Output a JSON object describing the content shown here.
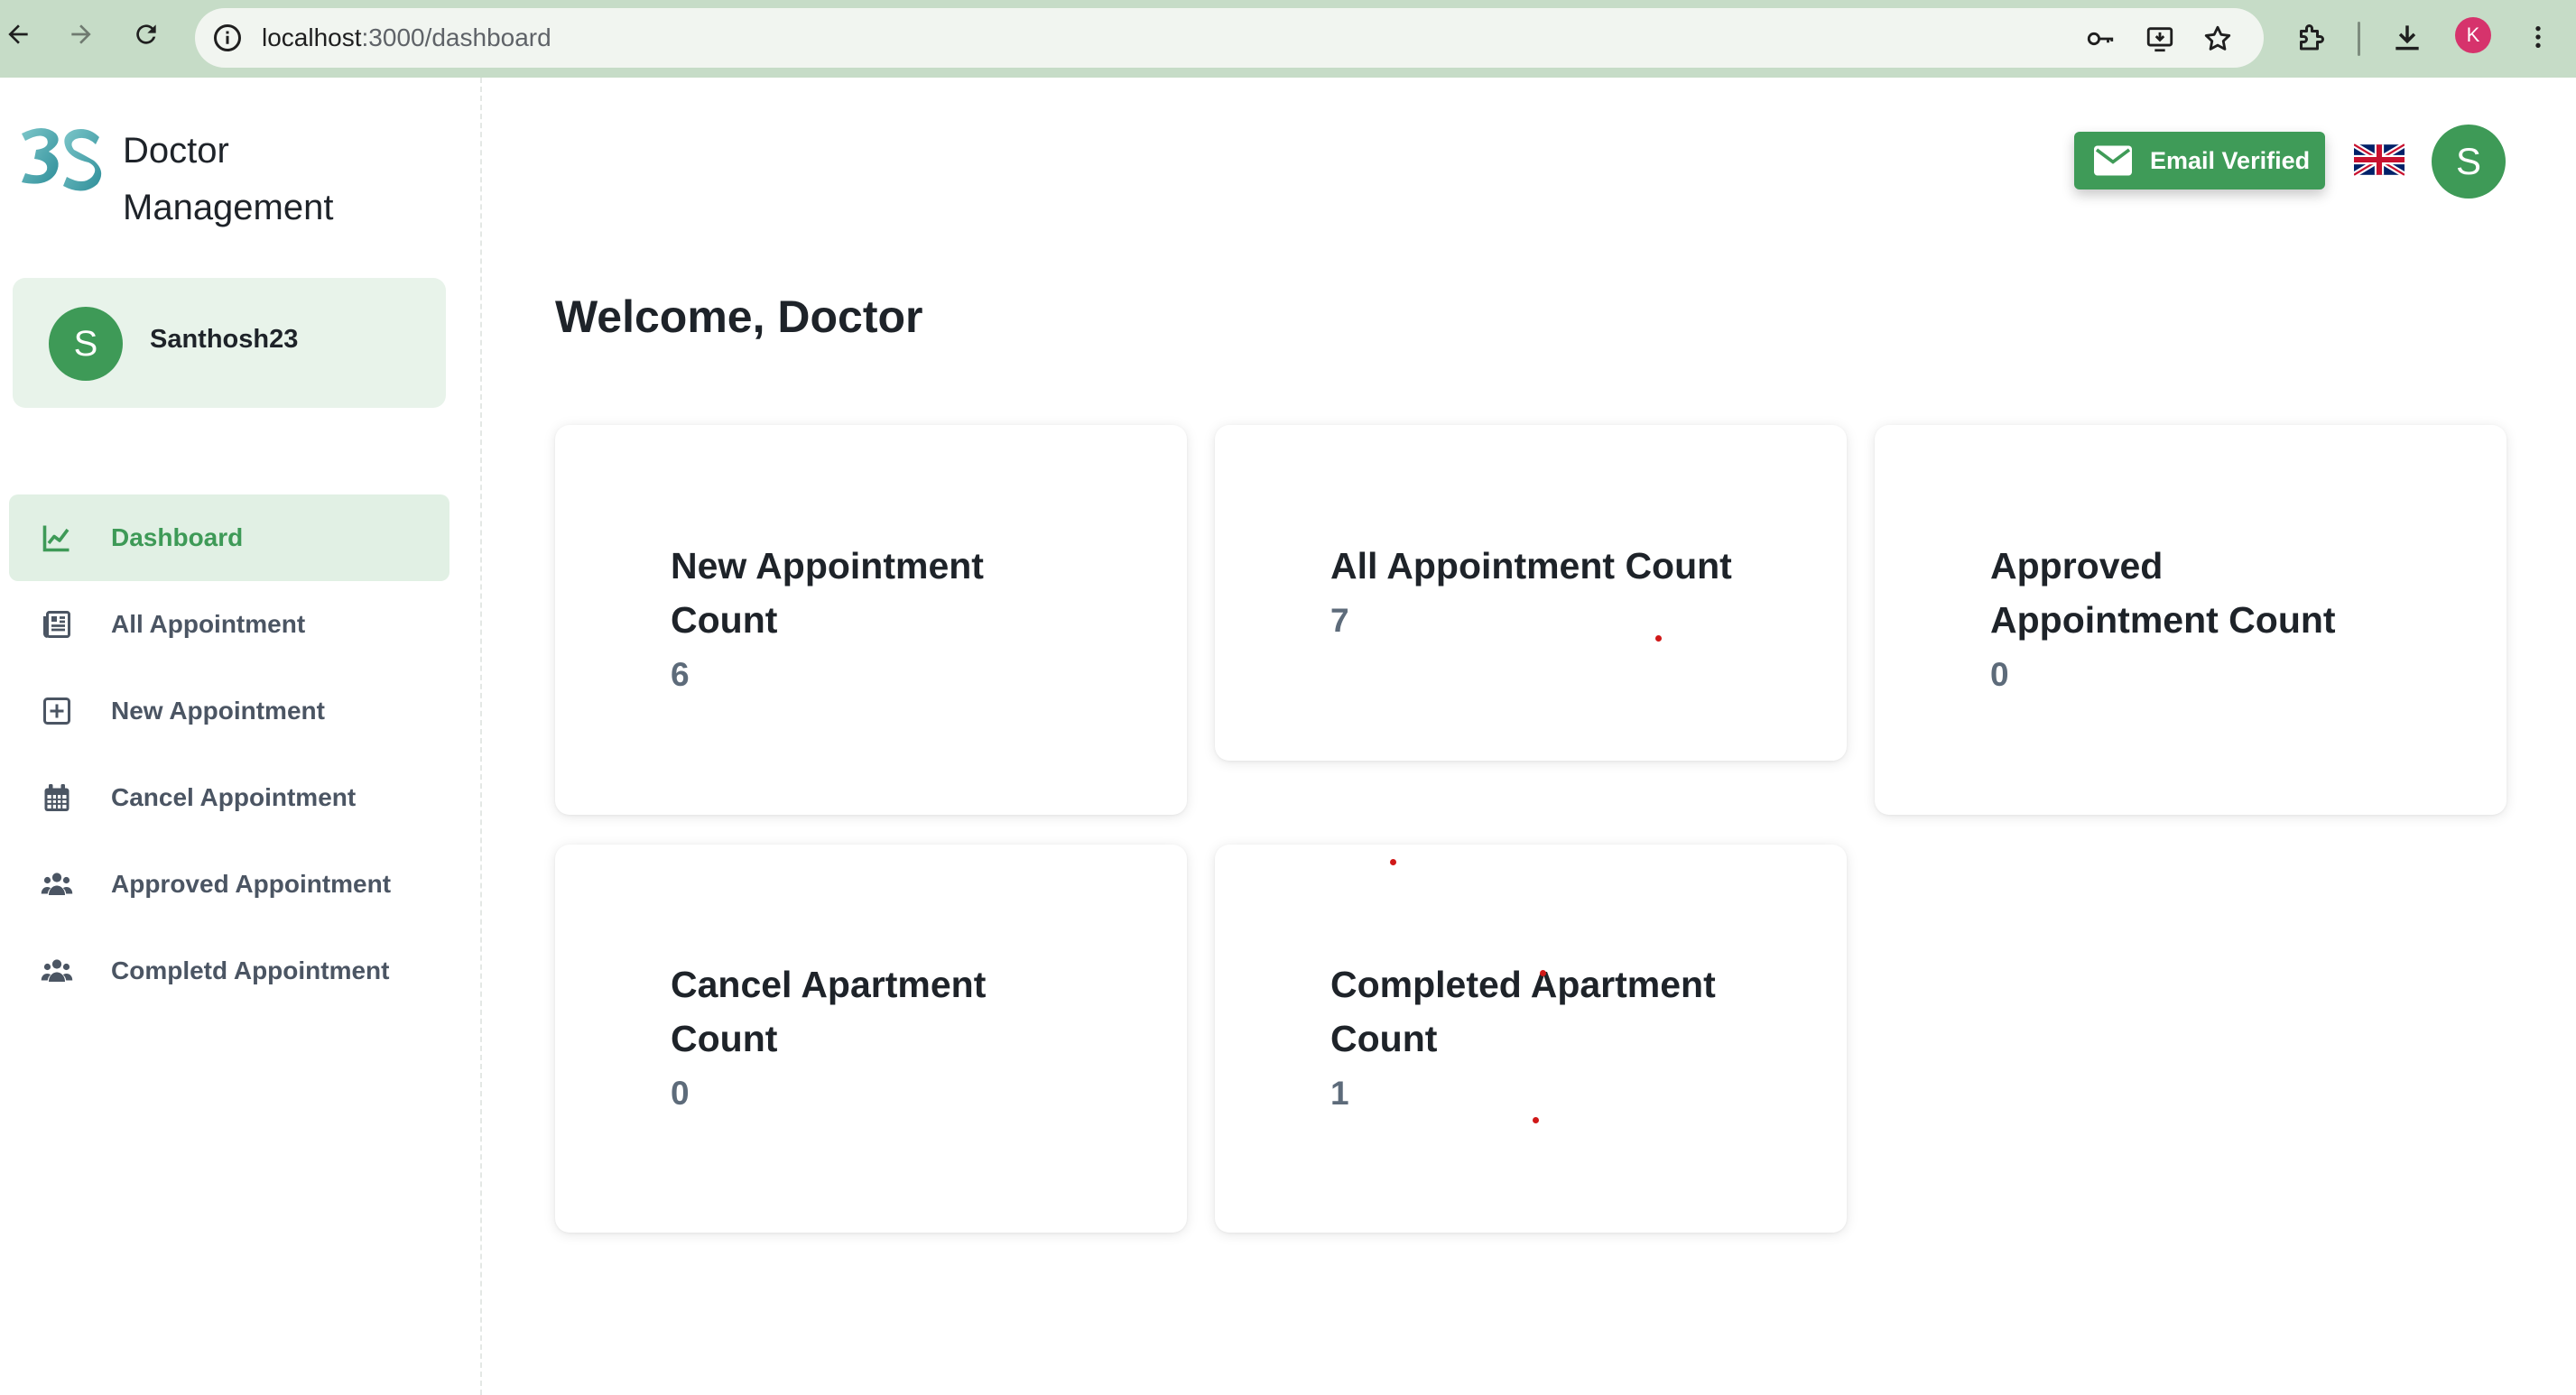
{
  "browser": {
    "url_host": "localhost",
    "url_path": ":3000/dashboard",
    "profile_initial": "K"
  },
  "sidebar": {
    "brand": "Doctor Management",
    "brand_line1": "Doctor",
    "brand_line2": "Management",
    "user": {
      "initial": "S",
      "name": "Santhosh23"
    },
    "items": [
      {
        "label": "Dashboard",
        "icon": "line-chart-icon",
        "active": true
      },
      {
        "label": "All Appointment",
        "icon": "newspaper-icon",
        "active": false
      },
      {
        "label": "New Appointment",
        "icon": "plus-square-icon",
        "active": false
      },
      {
        "label": "Cancel Appointment",
        "icon": "calendar-icon",
        "active": false
      },
      {
        "label": "Approved Appointment",
        "icon": "users-icon",
        "active": false
      },
      {
        "label": "Completd Appointment",
        "icon": "users-icon",
        "active": false
      }
    ]
  },
  "header": {
    "email_status": "Email Verified",
    "language_flag": "uk-flag-icon",
    "avatar_initial": "S"
  },
  "main": {
    "welcome": "Welcome, Doctor",
    "cards": [
      {
        "title_line1": "New Appointment",
        "title_line2": "Count",
        "value": "6"
      },
      {
        "title_line1": "All Appointment Count",
        "title_line2": "",
        "value": "7"
      },
      {
        "title_line1": "Approved",
        "title_line2": "Appointment Count",
        "value": "0"
      },
      {
        "title_line1": "Cancel Apartment",
        "title_line2": "Count",
        "value": "0"
      },
      {
        "title_line1": "Completed Apartment",
        "title_line2": "Count",
        "value": "1"
      }
    ]
  },
  "colors": {
    "accent": "#3e9a57",
    "active_bg": "#e1f0e4",
    "chrome_bg": "#c6dcc7"
  }
}
